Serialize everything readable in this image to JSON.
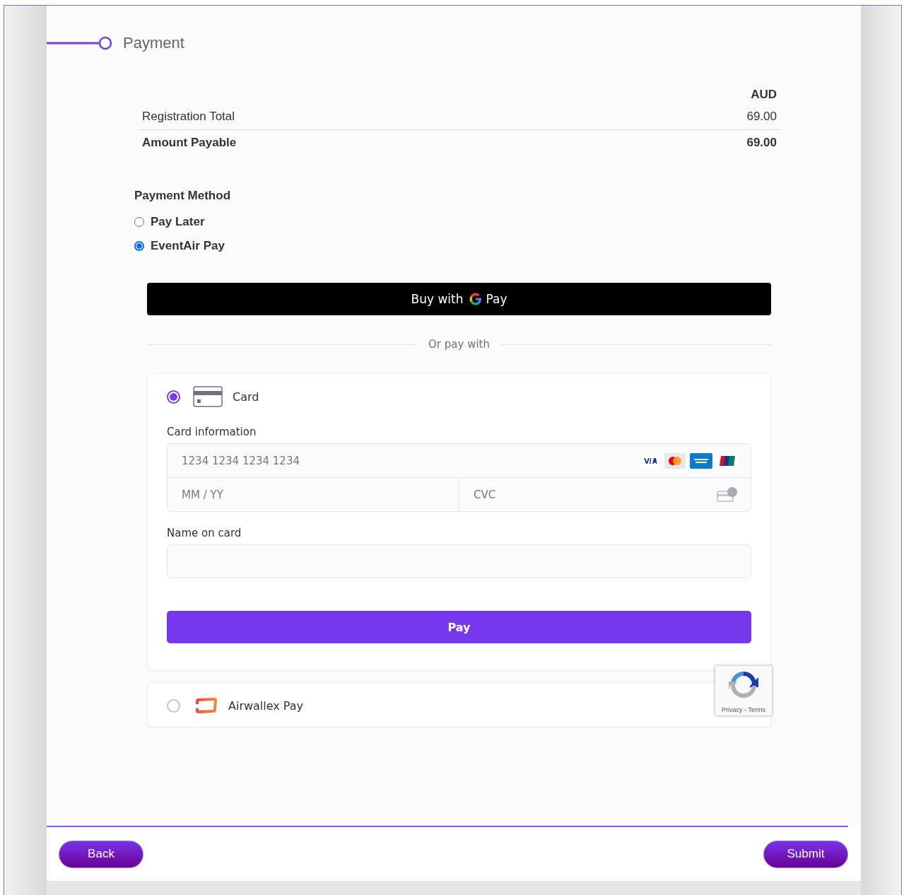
{
  "stepper": {
    "title": "Payment"
  },
  "summary": {
    "currency": "AUD",
    "rows": [
      {
        "label": "Registration Total",
        "value": "69.00",
        "kind": "normal"
      },
      {
        "label": "Amount Payable",
        "value": "69.00",
        "kind": "total"
      }
    ]
  },
  "payment_method": {
    "heading": "Payment Method",
    "options": [
      {
        "label": "Pay Later",
        "selected": false
      },
      {
        "label": "EventAir Pay",
        "selected": true
      }
    ]
  },
  "gpay_button": {
    "label_before": "Buy with",
    "label_after": "Pay"
  },
  "divider_text": "Or pay with",
  "methods": [
    {
      "kind": "card",
      "label": "Card",
      "selected": true
    },
    {
      "kind": "airwallex",
      "label": "Airwallex Pay",
      "selected": false
    }
  ],
  "card_form": {
    "card_info_label": "Card information",
    "card_number_placeholder": "1234 1234 1234 1234",
    "expiry_placeholder": "MM / YY",
    "cvc_placeholder": "CVC",
    "name_label": "Name on card",
    "pay_button": "Pay"
  },
  "recaptcha": {
    "links": "Privacy - Terms"
  },
  "footer": {
    "back": "Back",
    "submit": "Submit"
  }
}
